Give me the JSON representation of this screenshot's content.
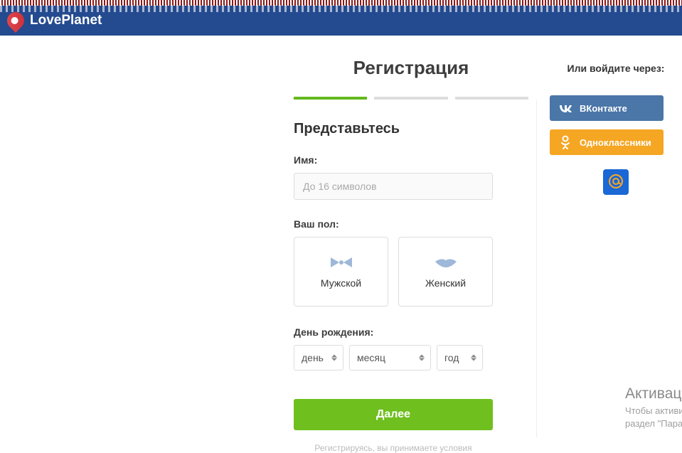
{
  "header": {
    "logo_text": "LovePlanet"
  },
  "registration": {
    "title": "Регистрация",
    "section_title": "Представьтесь",
    "name_label": "Имя:",
    "name_placeholder": "До 16 символов",
    "gender_label": "Ваш пол:",
    "gender_male": "Мужской",
    "gender_female": "Женский",
    "birthday_label": "День рождения:",
    "day_placeholder": "день",
    "month_placeholder": "месяц",
    "year_placeholder": "год",
    "next_button": "Далее",
    "terms_text": "Регистрируясь, вы принимаете условия"
  },
  "alt_login": {
    "title": "Или войдите через:",
    "vk_label": "ВКонтакте",
    "ok_label": "Одноклассники"
  },
  "watermark": {
    "title": "Активация Windows",
    "line1": "Чтобы активировать",
    "line2": "раздел \"Параметры\""
  }
}
